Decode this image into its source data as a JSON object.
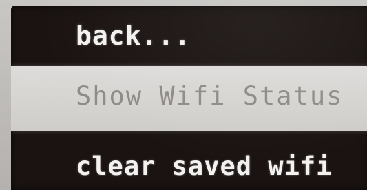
{
  "menu": {
    "items": [
      {
        "label": "back..."
      },
      {
        "label": "Show Wifi Status",
        "selected": true
      },
      {
        "label": "clear saved wifi"
      }
    ]
  },
  "colors": {
    "screen_background": "#1a1312",
    "item_text": "#f4f2f0",
    "selected_background": "#d6d4d1",
    "selected_text": "#8f8b88"
  }
}
